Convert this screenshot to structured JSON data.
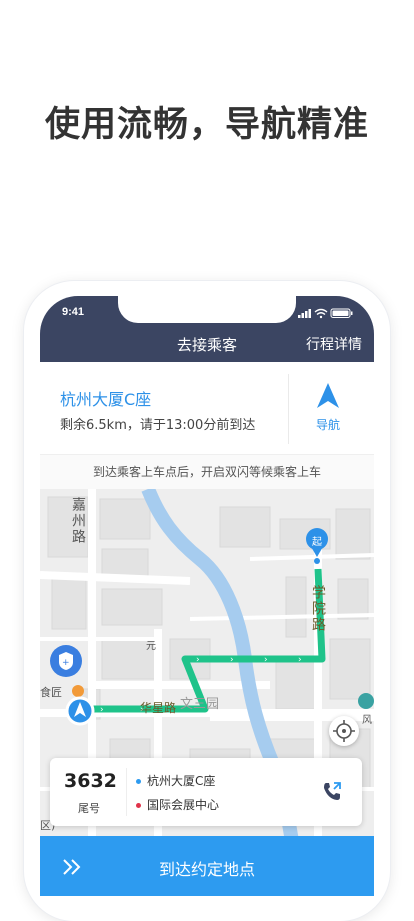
{
  "headline": "使用流畅，导航精准",
  "status_bar": {
    "time": "9:41"
  },
  "header": {
    "title": "去接乘客",
    "right_link": "行程详情"
  },
  "trip": {
    "destination": "杭州大厦C座",
    "remaining": "剩余6.5km，请于13:00分前到达",
    "nav_label": "导航"
  },
  "notice": "到达乘客上车点后，开启双闪等候乘客上车",
  "map": {
    "start_marker": "起",
    "road_jiazhou": "嘉州路",
    "road_xueyuan": "学院路",
    "road_huaxing": "华星路",
    "park_label": "文三园",
    "poi_yuan": "元",
    "poi_shijiang": "食匠",
    "poi_qu": "区)",
    "poi_feng": "风"
  },
  "order": {
    "tail_number": "3632",
    "tail_label": "尾号",
    "pickup": "杭州大厦C座",
    "dropoff": "国际会展中心"
  },
  "action_button": "到达约定地点",
  "colors": {
    "navbar": "#3b4562",
    "accent": "#2d91e8",
    "route": "#1fc38a",
    "pickup_dot": "#2d9bf0",
    "dropoff_dot": "#e0334a",
    "bottom_bar": "#2d9bf0"
  }
}
